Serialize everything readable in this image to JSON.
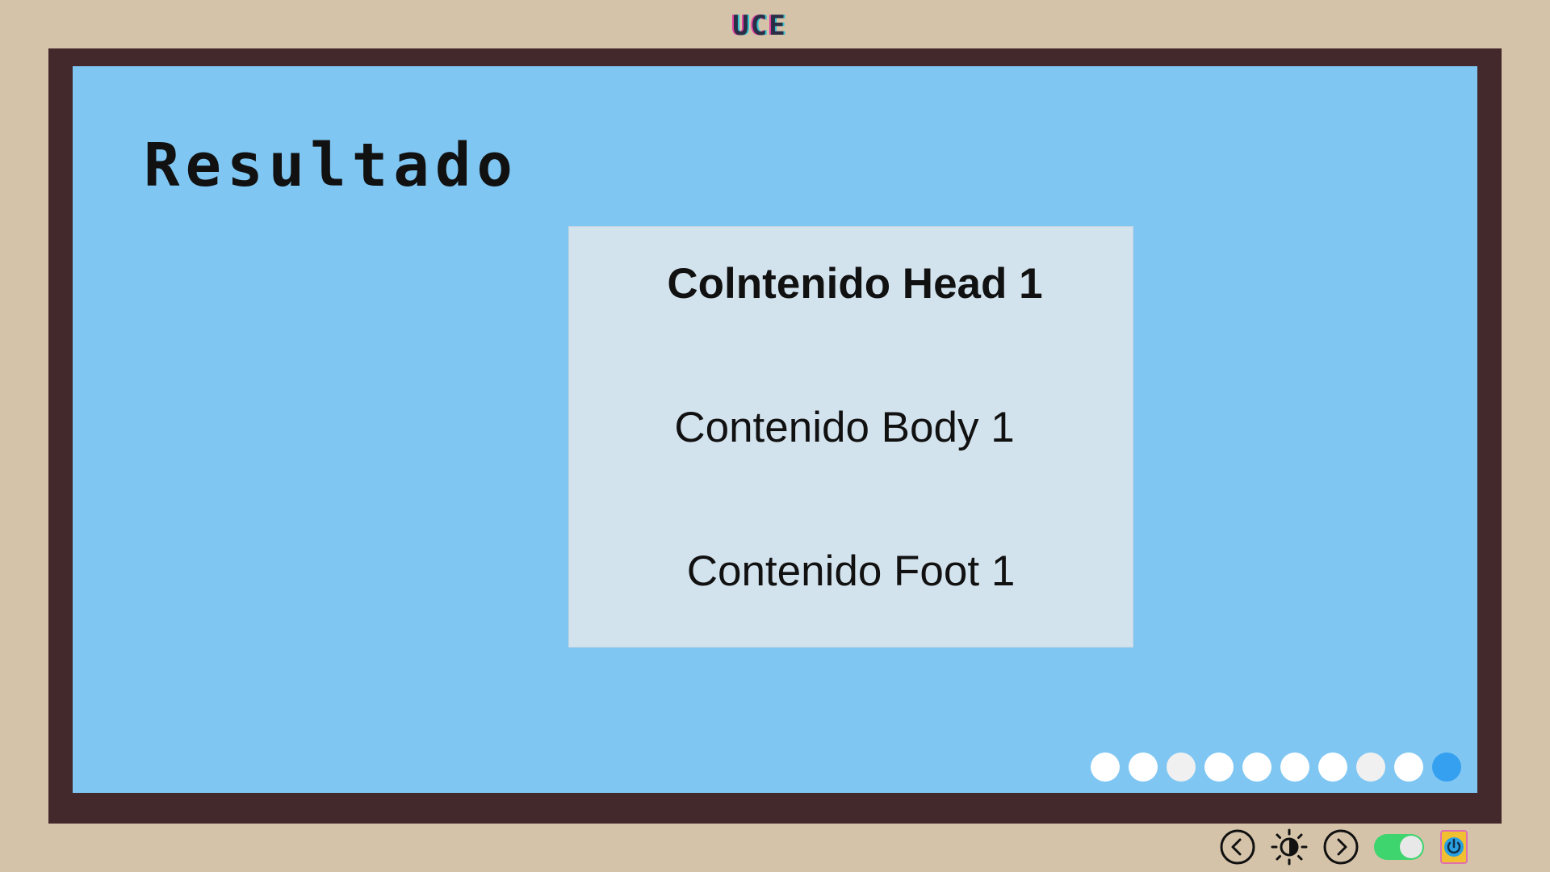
{
  "header": {
    "brand": "UCE"
  },
  "slide": {
    "title": "Resultado",
    "card": {
      "head": "Colntenido Head 1",
      "body": "Contenido Body 1",
      "foot": "Contenido Foot 1"
    }
  },
  "pager": {
    "total": 10,
    "active_index": 10
  },
  "controls": {
    "prev_icon": "chevron-left-circle-icon",
    "brightness_icon": "brightness-icon",
    "next_icon": "chevron-right-circle-icon",
    "toggle_on": true,
    "power_icon": "power-icon"
  },
  "colors": {
    "background": "#d4c3a9",
    "bezel": "#43292b",
    "screen": "#7fc6f2",
    "card": "#d3e3ee",
    "active_dot": "#36a0f0",
    "toggle": "#3ed46e"
  }
}
